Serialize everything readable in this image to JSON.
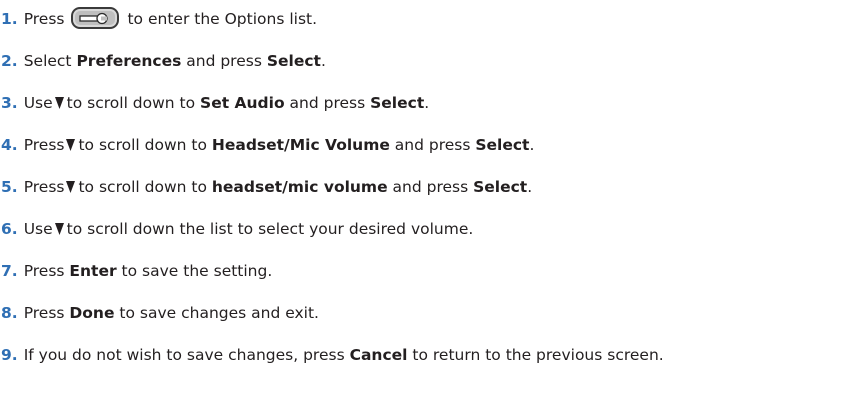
{
  "steps": [
    {
      "number": "1.",
      "parts": [
        "Press",
        "to enter the Options list."
      ]
    },
    {
      "number": "2.",
      "parts": [
        "Select ",
        "Preferences",
        " and press ",
        "Select",
        "."
      ]
    },
    {
      "number": "3.",
      "parts": [
        "Use",
        "to scroll down to ",
        "Set Audio",
        " and press ",
        "Select",
        "."
      ]
    },
    {
      "number": "4.",
      "parts": [
        "Press",
        "to scroll down to ",
        "Headset/Mic Volume",
        " and press ",
        "Select",
        "."
      ]
    },
    {
      "number": "5.",
      "parts": [
        "Press",
        "to scroll down to ",
        "headset/mic volume",
        " and press ",
        "Select",
        "."
      ]
    },
    {
      "number": "6.",
      "parts": [
        "Use",
        "to scroll down the list to select your desired volume."
      ]
    },
    {
      "number": "7.",
      "parts": [
        "Press ",
        "Enter",
        " to save the setting."
      ]
    },
    {
      "number": "8.",
      "parts": [
        "Press ",
        "Done",
        " to save changes and exit."
      ]
    },
    {
      "number": "9.",
      "parts": [
        "If you do not wish to save changes, press ",
        "Cancel",
        " to return to the previous screen."
      ]
    }
  ],
  "icons": {
    "options_key": "options-key-icon",
    "scroll_down": "down-arrow-icon"
  },
  "colors": {
    "step_number": "#2f6fb4",
    "text": "#231f20"
  }
}
